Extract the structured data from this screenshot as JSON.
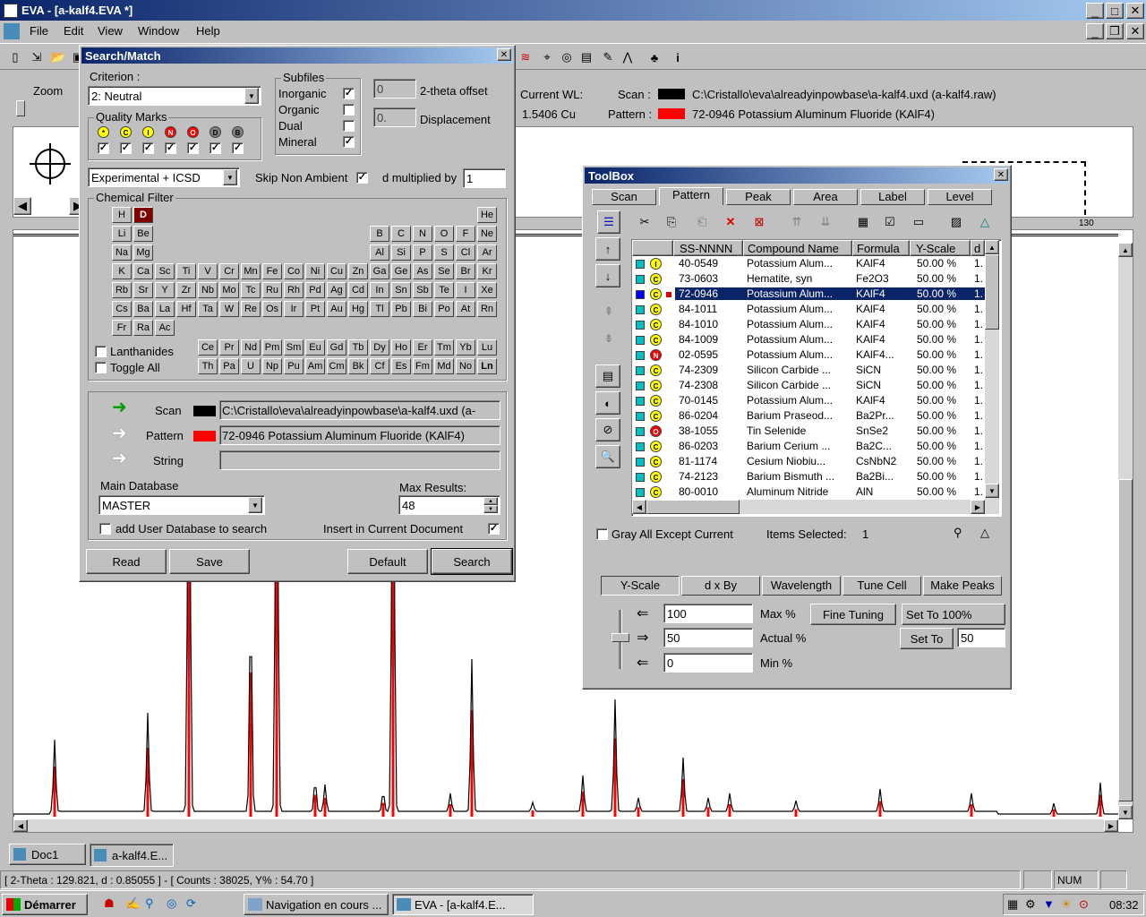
{
  "app": {
    "title": "EVA - [a-kalf4.EVA *]"
  },
  "menu": [
    "File",
    "Edit",
    "View",
    "Window",
    "Help"
  ],
  "header": {
    "zoom_label": "Zoom",
    "current_wl_label": "Current WL:",
    "current_wl_value": "1.5406 Cu",
    "scan_label": "Scan :",
    "scan_value": "C:\\Cristallo\\eva\\alreadyinpowbase\\a-kalf4.uxd (a-kalf4.raw)",
    "pattern_label": "Pattern :",
    "pattern_value": "72-0946 Potassium Aluminum Fluoride (KAlF4)",
    "axis_tick": "130"
  },
  "search_match": {
    "title": "Search/Match",
    "criterion_label": "Criterion :",
    "criterion_value": "2: Neutral",
    "subfiles_label": "Subfiles",
    "subfiles": [
      {
        "label": "Inorganic",
        "checked": true
      },
      {
        "label": "Organic",
        "checked": false
      },
      {
        "label": "Dual",
        "checked": false
      },
      {
        "label": "Mineral",
        "checked": true
      }
    ],
    "twotheta_value": "0",
    "twotheta_label": "2-theta offset",
    "displacement_value": "0.",
    "displacement_label": "Displacement",
    "quality_label": "Quality Marks",
    "quality_marks": [
      "*",
      "C",
      "I",
      "N",
      "O",
      "D",
      "B"
    ],
    "database_select": "Experimental + ICSD",
    "skip_label": "Skip Non Ambient",
    "d_mult_label": "d multiplied by",
    "d_mult_value": "1",
    "chem_filter_label": "Chemical Filter",
    "lanthanides": "Lanthanides",
    "toggle_all": "Toggle All",
    "scan_label": "Scan",
    "scan_value": "C:\\Cristallo\\eva\\alreadyinpowbase\\a-kalf4.uxd (a-",
    "pattern_label": "Pattern",
    "pattern_value": "72-0946 Potassium Aluminum Fluoride (KAlF4)",
    "string_label": "String",
    "string_value": "",
    "main_db_label": "Main Database",
    "main_db_value": "MASTER",
    "max_results_label": "Max Results:",
    "max_results_value": "48",
    "add_user_db": "add User Database to search",
    "insert_current": "Insert in Current Document",
    "buttons": {
      "read": "Read",
      "save": "Save",
      "default": "Default",
      "search": "Search"
    }
  },
  "elements": [
    [
      "H",
      0,
      0
    ],
    [
      "D",
      1,
      0
    ],
    [
      "He",
      17,
      0
    ],
    [
      "Li",
      0,
      1
    ],
    [
      "Be",
      1,
      1
    ],
    [
      "B",
      12,
      1
    ],
    [
      "C",
      13,
      1
    ],
    [
      "N",
      14,
      1
    ],
    [
      "O",
      15,
      1
    ],
    [
      "F",
      16,
      1
    ],
    [
      "Ne",
      17,
      1
    ],
    [
      "Na",
      0,
      2
    ],
    [
      "Mg",
      1,
      2
    ],
    [
      "Al",
      12,
      2
    ],
    [
      "Si",
      13,
      2
    ],
    [
      "P",
      14,
      2
    ],
    [
      "S",
      15,
      2
    ],
    [
      "Cl",
      16,
      2
    ],
    [
      "Ar",
      17,
      2
    ],
    [
      "K",
      0,
      3
    ],
    [
      "Ca",
      1,
      3
    ],
    [
      "Sc",
      2,
      3
    ],
    [
      "Ti",
      3,
      3
    ],
    [
      "V",
      4,
      3
    ],
    [
      "Cr",
      5,
      3
    ],
    [
      "Mn",
      6,
      3
    ],
    [
      "Fe",
      7,
      3
    ],
    [
      "Co",
      8,
      3
    ],
    [
      "Ni",
      9,
      3
    ],
    [
      "Cu",
      10,
      3
    ],
    [
      "Zn",
      11,
      3
    ],
    [
      "Ga",
      12,
      3
    ],
    [
      "Ge",
      13,
      3
    ],
    [
      "As",
      14,
      3
    ],
    [
      "Se",
      15,
      3
    ],
    [
      "Br",
      16,
      3
    ],
    [
      "Kr",
      17,
      3
    ],
    [
      "Rb",
      0,
      4
    ],
    [
      "Sr",
      1,
      4
    ],
    [
      "Y",
      2,
      4
    ],
    [
      "Zr",
      3,
      4
    ],
    [
      "Nb",
      4,
      4
    ],
    [
      "Mo",
      5,
      4
    ],
    [
      "Tc",
      6,
      4
    ],
    [
      "Ru",
      7,
      4
    ],
    [
      "Rh",
      8,
      4
    ],
    [
      "Pd",
      9,
      4
    ],
    [
      "Ag",
      10,
      4
    ],
    [
      "Cd",
      11,
      4
    ],
    [
      "In",
      12,
      4
    ],
    [
      "Sn",
      13,
      4
    ],
    [
      "Sb",
      14,
      4
    ],
    [
      "Te",
      15,
      4
    ],
    [
      "I",
      16,
      4
    ],
    [
      "Xe",
      17,
      4
    ],
    [
      "Cs",
      0,
      5
    ],
    [
      "Ba",
      1,
      5
    ],
    [
      "La",
      2,
      5
    ],
    [
      "Hf",
      3,
      5
    ],
    [
      "Ta",
      4,
      5
    ],
    [
      "W",
      5,
      5
    ],
    [
      "Re",
      6,
      5
    ],
    [
      "Os",
      7,
      5
    ],
    [
      "Ir",
      8,
      5
    ],
    [
      "Pt",
      9,
      5
    ],
    [
      "Au",
      10,
      5
    ],
    [
      "Hg",
      11,
      5
    ],
    [
      "Tl",
      12,
      5
    ],
    [
      "Pb",
      13,
      5
    ],
    [
      "Bi",
      14,
      5
    ],
    [
      "Po",
      15,
      5
    ],
    [
      "At",
      16,
      5
    ],
    [
      "Rn",
      17,
      5
    ],
    [
      "Fr",
      0,
      6
    ],
    [
      "Ra",
      1,
      6
    ],
    [
      "Ac",
      2,
      6
    ]
  ],
  "lanthanides_row": [
    "Ce",
    "Pr",
    "Nd",
    "Pm",
    "Sm",
    "Eu",
    "Gd",
    "Tb",
    "Dy",
    "Ho",
    "Er",
    "Tm",
    "Yb",
    "Lu"
  ],
  "actinides_row": [
    "Th",
    "Pa",
    "U",
    "Np",
    "Pu",
    "Am",
    "Cm",
    "Bk",
    "Cf",
    "Es",
    "Fm",
    "Md",
    "No",
    "Ln"
  ],
  "toolbox": {
    "title": "ToolBox",
    "tabs": [
      "Scan",
      "Pattern",
      "Peak",
      "Area",
      "Label",
      "Level"
    ],
    "columns": [
      "SS-NNNN",
      "Compound Name",
      "Formula",
      "Y-Scale",
      "d"
    ],
    "rows": [
      {
        "color": "#00c0c0",
        "mark": "I",
        "mc": "#ffff00",
        "code": "40-0549",
        "name": "Potassium Alum...",
        "formula": "KAlF4",
        "ys": "50.00 %",
        "d": "1."
      },
      {
        "color": "#00c0c0",
        "mark": "C",
        "mc": "#ffff00",
        "code": "73-0603",
        "name": "Hematite, syn",
        "formula": "Fe2O3",
        "ys": "50.00 %",
        "d": "1."
      },
      {
        "color": "#0000ff",
        "mark": "C",
        "mc": "#ffff00",
        "code": "72-0946",
        "name": "Potassium Alum...",
        "formula": "KAlF4",
        "ys": "50.00 %",
        "d": "1.",
        "sel": true
      },
      {
        "color": "#00c0c0",
        "mark": "C",
        "mc": "#ffff00",
        "code": "84-1011",
        "name": "Potassium Alum...",
        "formula": "KAlF4",
        "ys": "50.00 %",
        "d": "1."
      },
      {
        "color": "#00c0c0",
        "mark": "C",
        "mc": "#ffff00",
        "code": "84-1010",
        "name": "Potassium Alum...",
        "formula": "KAlF4",
        "ys": "50.00 %",
        "d": "1."
      },
      {
        "color": "#00c0c0",
        "mark": "C",
        "mc": "#ffff00",
        "code": "84-1009",
        "name": "Potassium Alum...",
        "formula": "KAlF4",
        "ys": "50.00 %",
        "d": "1."
      },
      {
        "color": "#00c0c0",
        "mark": "N",
        "mc": "#ff0000",
        "code": "02-0595",
        "name": "Potassium Alum...",
        "formula": "KAlF4...",
        "ys": "50.00 %",
        "d": "1."
      },
      {
        "color": "#00c0c0",
        "mark": "C",
        "mc": "#ffff00",
        "code": "74-2309",
        "name": "Silicon Carbide ...",
        "formula": "SiCN",
        "ys": "50.00 %",
        "d": "1."
      },
      {
        "color": "#00c0c0",
        "mark": "C",
        "mc": "#ffff00",
        "code": "74-2308",
        "name": "Silicon Carbide ...",
        "formula": "SiCN",
        "ys": "50.00 %",
        "d": "1."
      },
      {
        "color": "#00c0c0",
        "mark": "C",
        "mc": "#ffff00",
        "code": "70-0145",
        "name": "Potassium Alum...",
        "formula": "KAlF4",
        "ys": "50.00 %",
        "d": "1."
      },
      {
        "color": "#00c0c0",
        "mark": "C",
        "mc": "#ffff00",
        "code": "86-0204",
        "name": "Barium Praseod...",
        "formula": "Ba2Pr...",
        "ys": "50.00 %",
        "d": "1."
      },
      {
        "color": "#00c0c0",
        "mark": "O",
        "mc": "#ff0000",
        "code": "38-1055",
        "name": "Tin Selenide",
        "formula": "SnSe2",
        "ys": "50.00 %",
        "d": "1."
      },
      {
        "color": "#00c0c0",
        "mark": "C",
        "mc": "#ffff00",
        "code": "86-0203",
        "name": "Barium Cerium ...",
        "formula": "Ba2C...",
        "ys": "50.00 %",
        "d": "1."
      },
      {
        "color": "#00c0c0",
        "mark": "C",
        "mc": "#ffff00",
        "code": "81-1174",
        "name": "Cesium Niobiu...",
        "formula": "CsNbN2",
        "ys": "50.00 %",
        "d": "1."
      },
      {
        "color": "#00c0c0",
        "mark": "C",
        "mc": "#ffff00",
        "code": "74-2123",
        "name": "Barium Bismuth ...",
        "formula": "Ba2Bi...",
        "ys": "50.00 %",
        "d": "1."
      },
      {
        "color": "#00c0c0",
        "mark": "C",
        "mc": "#ffff00",
        "code": "80-0010",
        "name": "Aluminum Nitride",
        "formula": "AlN",
        "ys": "50.00 %",
        "d": "1."
      }
    ],
    "gray_all": "Gray All Except Current",
    "items_selected_label": "Items Selected:",
    "items_selected_value": "1",
    "bottom_tabs": [
      "Y-Scale",
      "d x By",
      "Wavelength",
      "Tune Cell",
      "Make Peaks"
    ],
    "max_value": "100",
    "max_label": "Max %",
    "actual_value": "50",
    "actual_label": "Actual %",
    "min_value": "0",
    "min_label": "Min %",
    "fine_tuning": "Fine Tuning",
    "set_100": "Set To 100%",
    "set_to": "Set To",
    "set_to_value": "50"
  },
  "doc_tabs": [
    "Doc1",
    "a-kalf4.E..."
  ],
  "status_bar": {
    "text": "[ 2-Theta : 129.821, d : 0.85055 ] - [ Counts : 38025, Y% : 54.70 ]",
    "num": "NUM"
  },
  "taskbar": {
    "start": "Démarrer",
    "tasks": [
      "Navigation en cours ...",
      "EVA - [a-kalf4.E..."
    ],
    "clock": "08:32"
  },
  "colors": {
    "titlebar": "#0a246a",
    "selection": "#0a246a",
    "scan_line": "#000000",
    "pattern_line": "#ff0000"
  }
}
